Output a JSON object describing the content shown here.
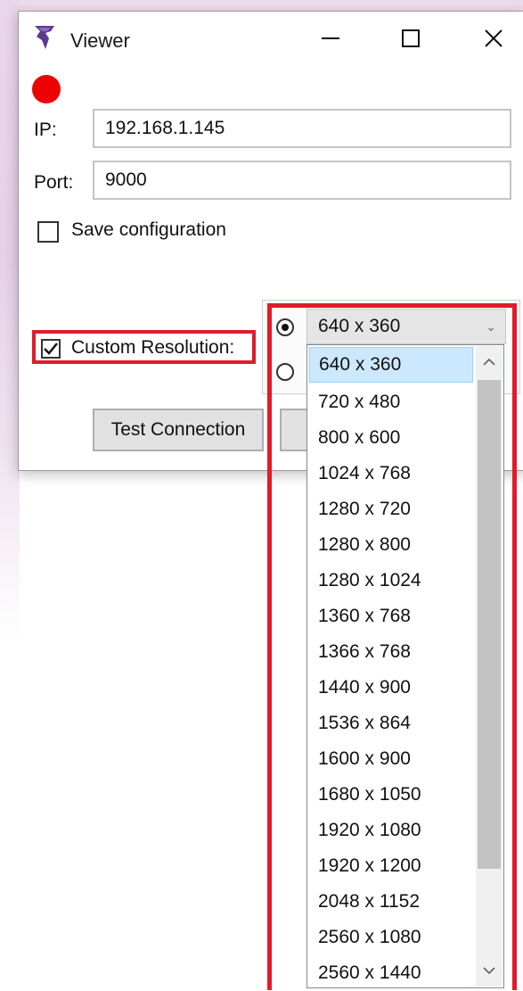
{
  "window": {
    "title": "Viewer",
    "status_color": "#ee0000",
    "icons": {
      "app": "app-icon",
      "minimize": "minimize-icon",
      "maximize": "maximize-icon",
      "close": "close-icon"
    }
  },
  "form": {
    "ip_label": "IP:",
    "ip_value": "192.168.1.145",
    "port_label": "Port:",
    "port_value": "9000",
    "save_config_label": "Save configuration",
    "save_config_checked": false,
    "custom_resolution_label": "Custom Resolution:",
    "custom_resolution_checked": true
  },
  "buttons": {
    "test_connection": "Test Connection"
  },
  "resolution": {
    "selected": "640 x 360",
    "radio_selected_index": 0,
    "options": [
      "640 x 360",
      "720 x 480",
      "800 x 600",
      "1024 x 768",
      "1280 x 720",
      "1280 x 800",
      "1280 x 1024",
      "1360 x 768",
      "1366 x 768",
      "1440 x 900",
      "1536 x 864",
      "1600 x 900",
      "1680 x 1050",
      "1920 x 1080",
      "1920 x 1200",
      "2048 x 1152",
      "2560 x 1080",
      "2560 x 1440"
    ]
  },
  "colors": {
    "highlight": "#e11b2a",
    "selected_item_bg": "#cce8ff"
  }
}
